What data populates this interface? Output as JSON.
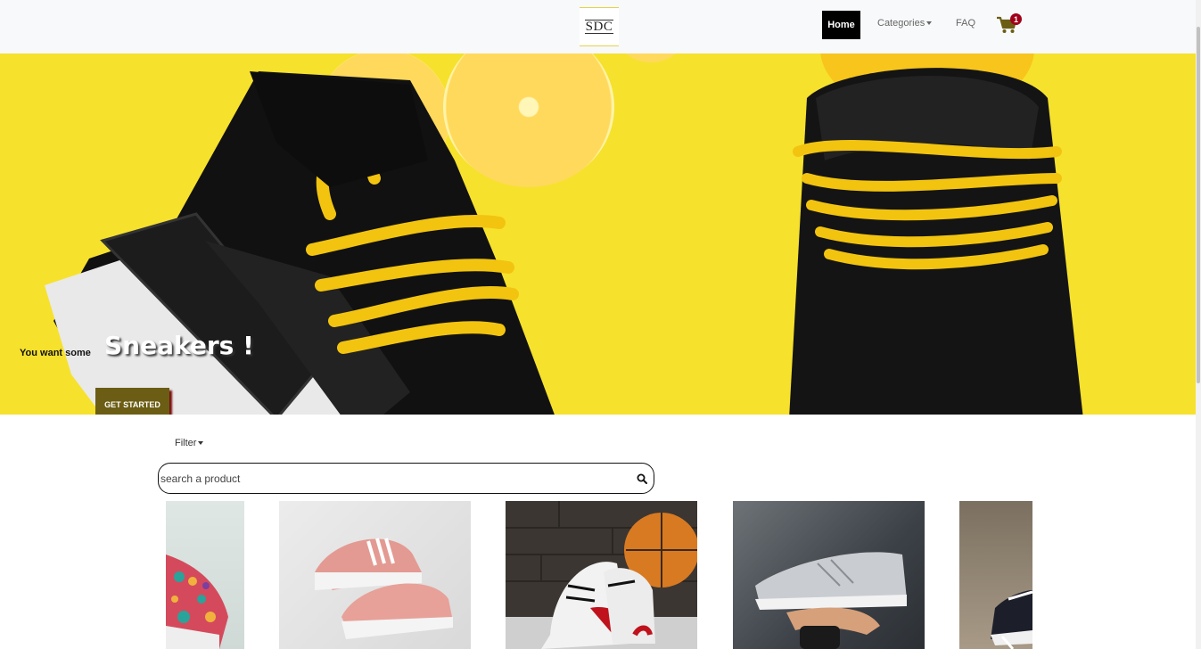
{
  "navbar": {
    "logo_text": "SDC",
    "home_label": "Home",
    "categories_label": "Categories",
    "faq_label": "FAQ",
    "cart_count": "1",
    "cart_color": "#6b5d14",
    "badge_color": "#a0001a"
  },
  "hero": {
    "lead_text": "You want some",
    "title": "Sneakers !",
    "cta_label": "GET STARTED",
    "background_color": "#f6e12d"
  },
  "filter": {
    "label": "Filter"
  },
  "search": {
    "placeholder": "search a product",
    "value": ""
  },
  "products": [
    {
      "image": "colorful-floral-sneakers"
    },
    {
      "image": "pink-sneakers"
    },
    {
      "image": "white-red-high-top-sneakers-with-basketball"
    },
    {
      "image": "grey-running-shoe-in-hand"
    },
    {
      "image": "black-sneaker-partial"
    }
  ]
}
